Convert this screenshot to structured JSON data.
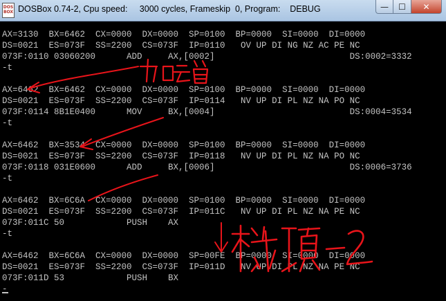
{
  "window": {
    "title": "DOSBox 0.74-2, Cpu speed:     3000 cycles, Frameskip  0, Program:    DEBUG",
    "icon_text": "DOS BOX",
    "minimize_glyph": "—",
    "maximize_glyph": "☐",
    "close_glyph": "✕"
  },
  "console": {
    "lines": [
      "AX=3130  BX=6462  CX=0000  DX=0000  SP=0100  BP=0000  SI=0000  DI=0000",
      "DS=0021  ES=073F  SS=2200  CS=073F  IP=0110   OV UP DI NG NZ AC PE NC",
      "073F:0110 03060200      ADD     AX,[0002]                          DS:0002=3332",
      "-t",
      "",
      "AX=6462  BX=6462  CX=0000  DX=0000  SP=0100  BP=0000  SI=0000  DI=0000",
      "DS=0021  ES=073F  SS=2200  CS=073F  IP=0114   NV UP DI PL NZ NA PO NC",
      "073F:0114 8B1E0400      MOV     BX,[0004]                          DS:0004=3534",
      "-t",
      "",
      "AX=6462  BX=3534  CX=0000  DX=0000  SP=0100  BP=0000  SI=0000  DI=0000",
      "DS=0021  ES=073F  SS=2200  CS=073F  IP=0118   NV UP DI PL NZ NA PO NC",
      "073F:0118 031E0600      ADD     BX,[0006]                          DS:0006=3736",
      "-t",
      "",
      "AX=6462  BX=6C6A  CX=0000  DX=0000  SP=0100  BP=0000  SI=0000  DI=0000",
      "DS=0021  ES=073F  SS=2200  CS=073F  IP=011C   NV UP DI PL NZ NA PE NC",
      "073F:011C 50            PUSH    AX",
      "-t",
      "",
      "AX=6462  BX=6C6A  CX=0000  DX=0000  SP=00FE  BP=0000  SI=0000  DI=0000",
      "DS=0021  ES=073F  SS=2200  CS=073F  IP=011D   NV UP DI PL NZ NA PE NC",
      "073F:011D 53            PUSH    BX",
      "-"
    ]
  },
  "annotations": {
    "color": "#e8141a",
    "note_add": "加运算",
    "note_stack": "栈顶-2"
  },
  "colors": {
    "console_bg": "#000000",
    "console_fg": "#c3c3c3",
    "titlebar": "#b6cde6"
  }
}
